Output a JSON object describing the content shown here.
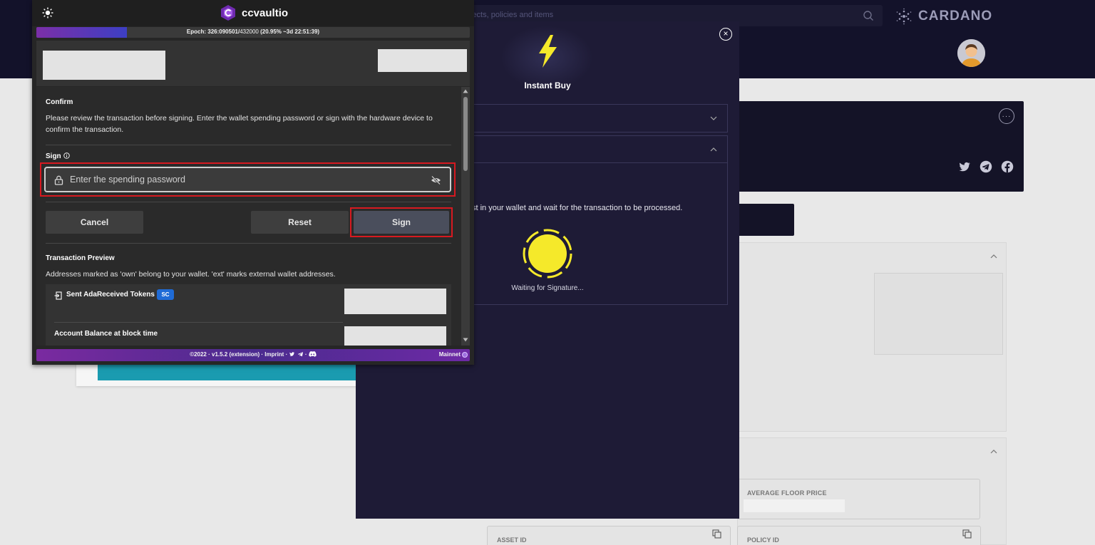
{
  "website": {
    "search_placeholder": "jects, policies and items",
    "brand": "CARDANO",
    "floor_price_label": "AVERAGE FLOOR PRICE",
    "asset_id_label": "ASSET ID",
    "policy_id_label": "POLICY ID"
  },
  "modal": {
    "title": "Instant Buy",
    "close_glyph": "×",
    "message": "st in your wallet and wait for the transaction to be processed.",
    "waiting": "Waiting for Signature..."
  },
  "extension": {
    "app_name": "ccvaultio",
    "epoch": {
      "label": "Epoch: 326:090501/",
      "total": "432000",
      "detail": " (20.95% ~3d 22:51:39)",
      "progress_percent": 20.95
    },
    "confirm": {
      "title": "Confirm",
      "description": "Please review the transaction before signing. Enter the wallet spending password or sign with the hardware device to confirm the transaction."
    },
    "sign": {
      "label": "Sign",
      "password_placeholder": "Enter the spending password"
    },
    "buttons": {
      "cancel": "Cancel",
      "reset": "Reset",
      "sign": "Sign"
    },
    "preview": {
      "title": "Transaction Preview",
      "description": "Addresses marked as 'own' belong to your wallet. 'ext' marks external wallet addresses.",
      "row_title": "Sent AdaReceived Tokens",
      "badge": "SC",
      "balance_label": "Account Balance at block time"
    },
    "footer": {
      "text": "©2022 · v1.5.2 (extension) · Imprint · ",
      "network": "Mainnet"
    }
  },
  "colors": {
    "accent_yellow": "#f5e92a",
    "highlight_red": "#d71920",
    "badge_blue": "#1f6bd6",
    "modal_bg": "#1e1b36"
  }
}
